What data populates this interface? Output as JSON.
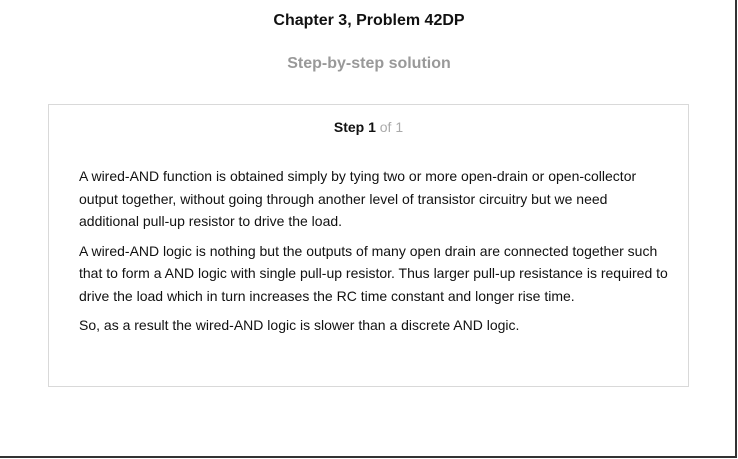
{
  "header": {
    "title": "Chapter 3, Problem 42DP",
    "subtitle": "Step-by-step solution"
  },
  "step": {
    "label": "Step 1",
    "of": "of 1"
  },
  "paragraphs": [
    "A wired-AND function is obtained simply by tying two or more open-drain or open-collector output together, without going through another level of transistor circuitry but we need additional pull-up resistor to drive the load.",
    "A wired-AND logic is nothing but the outputs of many open drain are connected together such that to form a AND logic with single pull-up resistor. Thus larger pull-up resistance is required to drive the load which in turn increases the RC time constant and longer rise time.",
    "So, as a result the wired-AND logic is slower than a discrete AND logic."
  ]
}
